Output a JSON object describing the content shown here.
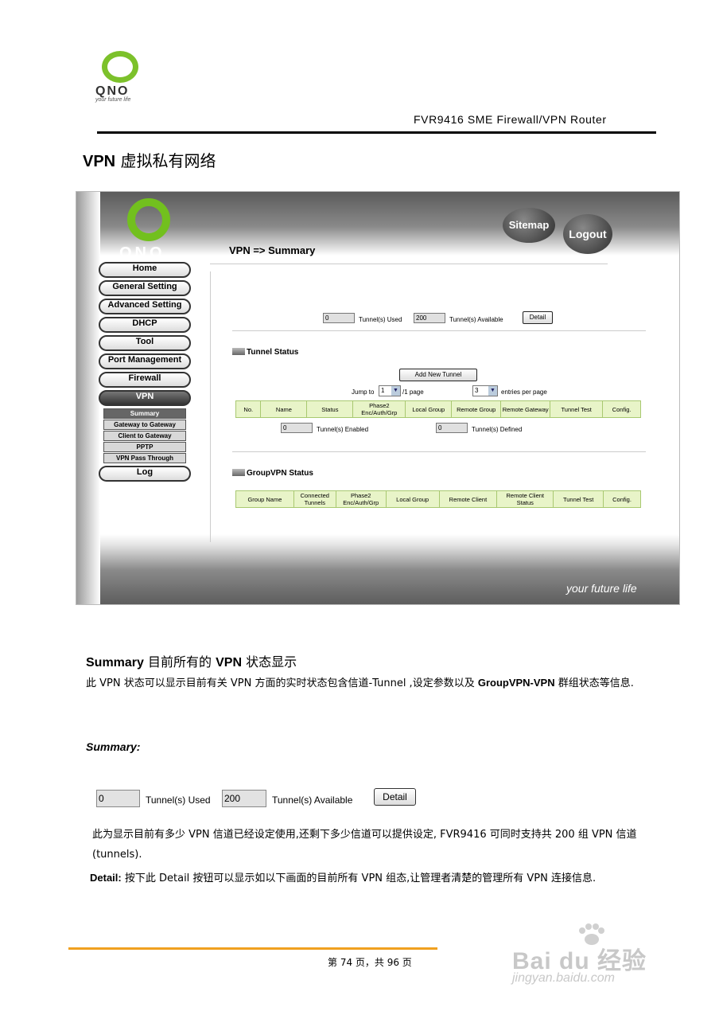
{
  "header": {
    "logo_text": "QNO",
    "logo_tagline": "your future life",
    "product_title": "FVR9416 SME Firewall/VPN Router"
  },
  "section": {
    "heading_bold": "VPN",
    "heading_text": " 虚拟私有网络"
  },
  "screenshot": {
    "logo_text": "QNO",
    "footer_tagline": "your future life",
    "sitemap_label": "Sitemap",
    "logout_label": "Logout",
    "page_title": "VPN => Summary",
    "nav": {
      "home": "Home",
      "general_setting": "General Setting",
      "advanced_setting": "Advanced Setting",
      "dhcp": "DHCP",
      "tool": "Tool",
      "port_management": "Port Management",
      "firewall": "Firewall",
      "vpn": "VPN",
      "sub": {
        "summary": "Summary",
        "gateway_to_gateway": "Gateway to Gateway",
        "client_to_gateway": "Client to Gateway",
        "pptp": "PPTP",
        "vpn_pass_through": "VPN Pass Through"
      },
      "log": "Log"
    },
    "tunnels_used_value": "0",
    "tunnels_used_label": "Tunnel(s) Used",
    "tunnels_available_value": "200",
    "tunnels_available_label": "Tunnel(s) Available",
    "detail_button": "Detail",
    "tunnel_status_heading": "Tunnel Status",
    "add_tunnel_button": "Add New Tunnel",
    "jump_to_label": "Jump to",
    "jump_to_value": "1",
    "page_suffix": "/1 page",
    "entries_value": "3",
    "entries_label": "entries per page",
    "tunnel_columns": [
      "No.",
      "Name",
      "Status",
      "Phase2 Enc/Auth/Grp",
      "Local Group",
      "Remote Group",
      "Remote Gateway",
      "Tunnel Test",
      "Config."
    ],
    "tunnels_enabled_value": "0",
    "tunnels_enabled_label": "Tunnel(s) Enabled",
    "tunnels_defined_value": "0",
    "tunnels_defined_label": "Tunnel(s) Defined",
    "groupvpn_heading": "GroupVPN Status",
    "group_columns": [
      "Group Name",
      "Connected Tunnels",
      "Phase2 Enc/Auth/Grp",
      "Local Group",
      "Remote Client",
      "Remote Client Status",
      "Tunnel Test",
      "Config."
    ]
  },
  "summary_section": {
    "heading_bold_1": "Summary",
    "heading_mid": " 目前所有的 ",
    "heading_bold_2": "VPN",
    "heading_tail": " 状态显示",
    "desc_part1": "此 VPN 状态可以显示目前有关 VPN 方面的实时状态包含信道-Tunnel ,设定参数以及 ",
    "desc_bold": "GroupVPN-VPN",
    "desc_part2": " 群组状态等信息.",
    "label": "Summary:"
  },
  "example": {
    "used_value": "0",
    "used_label": "Tunnel(s) Used",
    "available_value": "200",
    "available_label": "Tunnel(s) Available",
    "detail_button": "Detail"
  },
  "explanation": {
    "para1": "此为显示目前有多少 VPN 信道已经设定使用,还剩下多少信道可以提供设定, FVR9416 可同时支持共 200 组 VPN 信道(tunnels).",
    "detail_bold": "Detail:",
    "detail_text": " 按下此 Detail 按钮可以显示如以下画面的目前所有 VPN 组态,让管理者清楚的管理所有 VPN 连接信息."
  },
  "footer": {
    "page_text": "第 74 页，共 96 页"
  },
  "watermark": {
    "brand": "Bai du 经验",
    "site": "jingyan.baidu.com"
  }
}
